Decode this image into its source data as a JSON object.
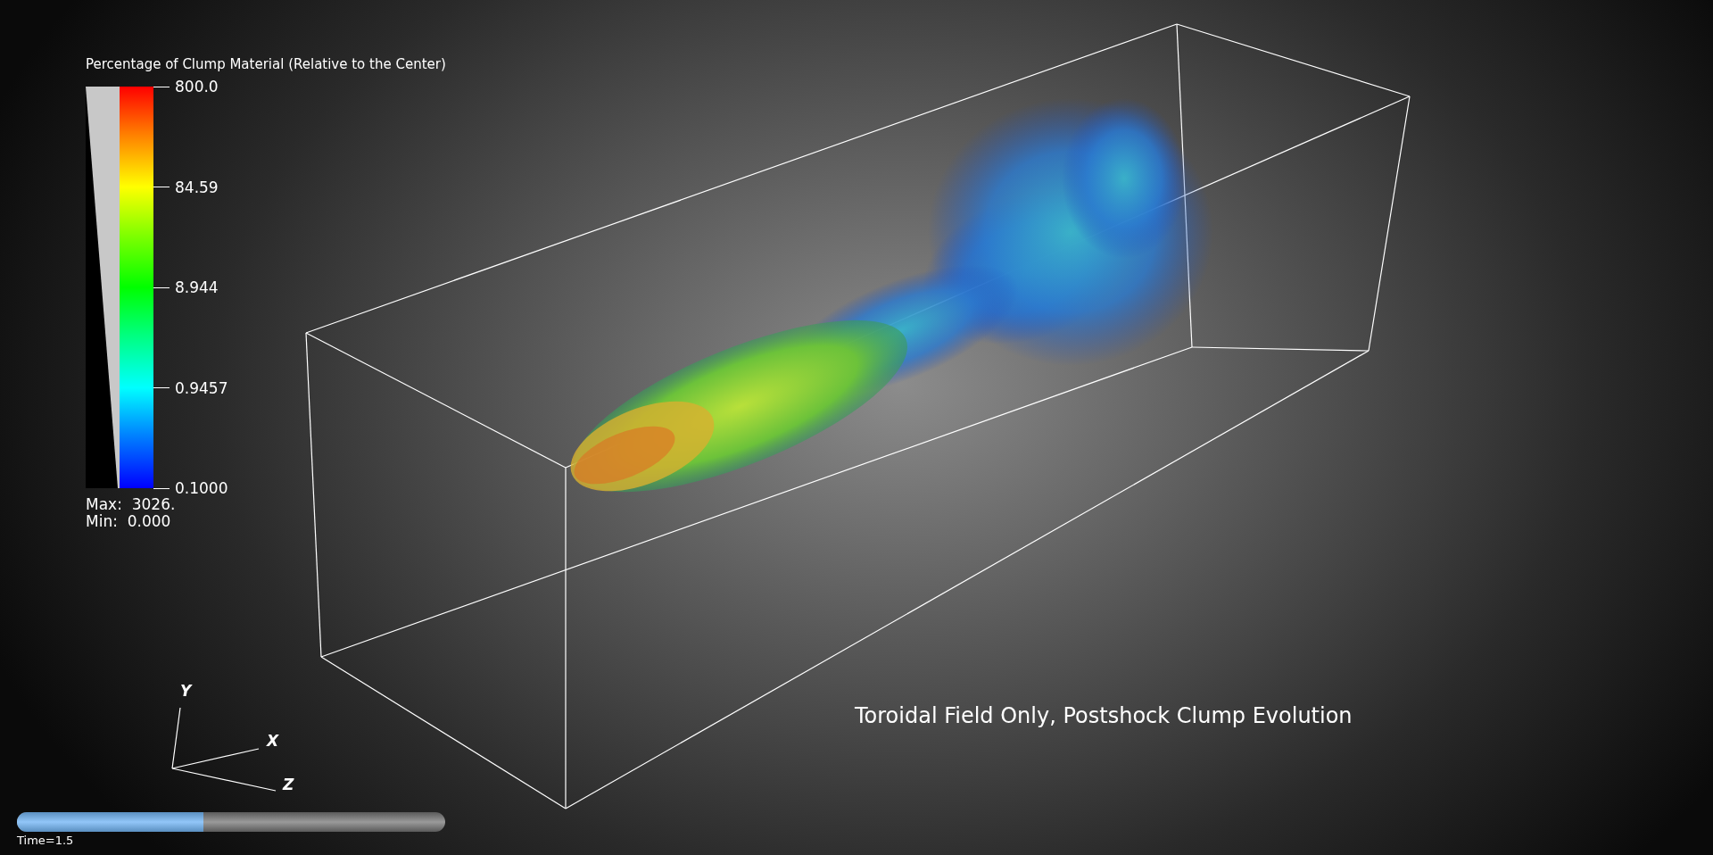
{
  "legend": {
    "title": "Percentage of Clump Material (Relative to the Center)",
    "ticks": [
      "800.0",
      "84.59",
      "8.944",
      "0.9457",
      "0.1000"
    ],
    "max_label": "Max:  3026.",
    "min_label": "Min:  0.000"
  },
  "axes": {
    "y": "Y",
    "x": "X",
    "z": "Z"
  },
  "plot_title": "Toroidal Field Only, Postshock Clump Evolution",
  "time_slider": {
    "level": 0.435,
    "label": "Time=1.5"
  }
}
